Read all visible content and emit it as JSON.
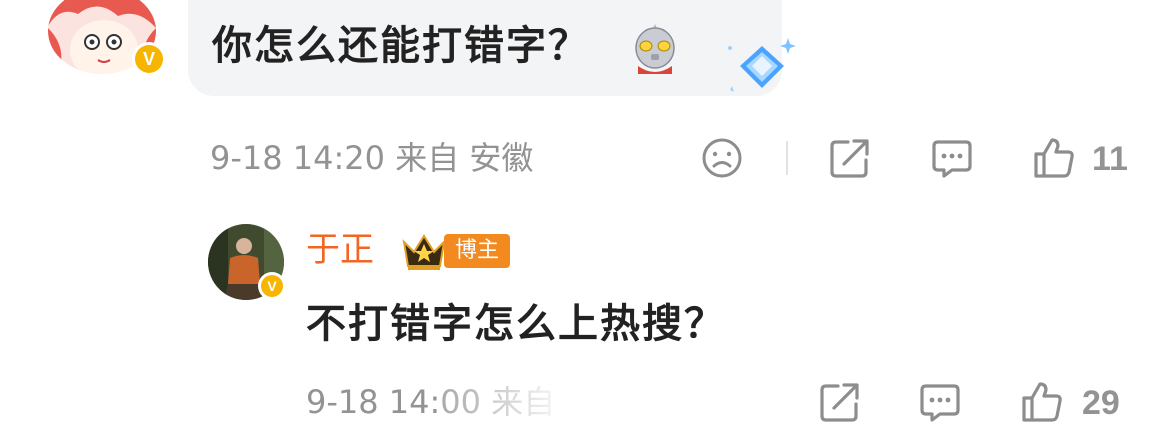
{
  "comment": {
    "text": "你怎么还能打错字？",
    "meta": "9-18 14:20 来自 安徽",
    "like_count": "11",
    "emoji": "ultraman-emoji",
    "sticker": "diamond-sticker",
    "badge_letter": "V"
  },
  "reply": {
    "author": "于正",
    "tag": "博主",
    "text": "不打错字怎么上热搜？",
    "meta": "9-18 14:00 来自",
    "like_count": "29",
    "badge_letter": "V"
  },
  "icons": {
    "sad": "sad-face-icon",
    "share": "share-icon",
    "comment": "comment-icon",
    "like": "thumbs-up-icon",
    "crown": "crown-icon"
  },
  "colors": {
    "name": "#f26522",
    "tag_bg": "#f28a1f",
    "badge": "#f7b500",
    "meta": "#939393",
    "bubble_bg": "#f3f4f6"
  }
}
